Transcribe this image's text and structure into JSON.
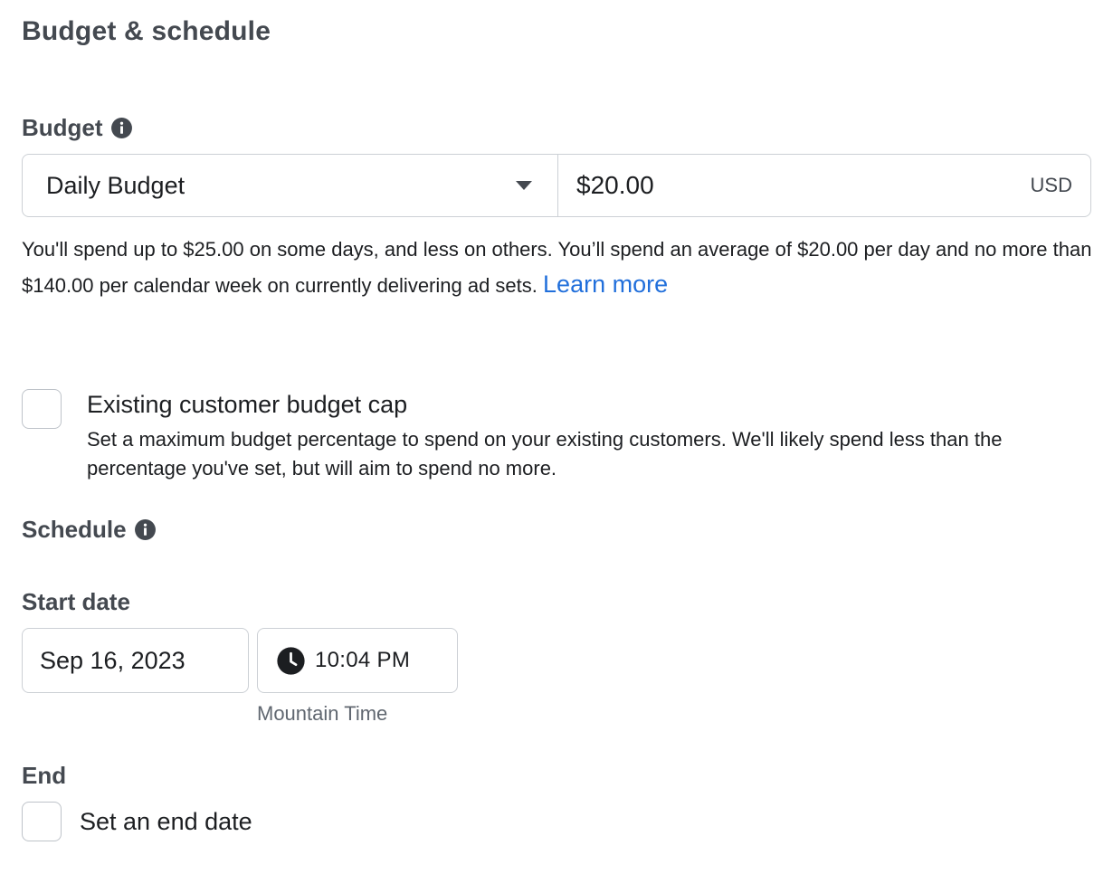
{
  "section": {
    "title": "Budget & schedule"
  },
  "budget": {
    "label": "Budget",
    "type_selected": "Daily Budget",
    "amount": "$20.00",
    "currency": "USD",
    "help_text": "You'll spend up to $25.00 on some days, and less on others. You’ll spend an average of $20.00 per day and no more than $140.00 per calendar week on currently delivering ad sets.",
    "learn_more": "Learn more"
  },
  "customer_cap": {
    "title": "Existing customer budget cap",
    "description": "Set a maximum budget percentage to spend on your existing customers. We'll likely spend less than the percentage you've set, but will aim to spend no more.",
    "checked": false
  },
  "schedule": {
    "label": "Schedule",
    "start_label": "Start date",
    "start_date": "Sep 16, 2023",
    "start_time": "10:04 PM",
    "timezone": "Mountain Time",
    "end_label": "End",
    "end_checkbox_label": "Set an end date",
    "end_checked": false
  },
  "colors": {
    "heading": "#444950",
    "text": "#1c1e21",
    "link": "#216fdb",
    "border": "#ccd0d5",
    "muted": "#606770"
  },
  "icons": {
    "info": "info-icon",
    "dropdown": "caret-down-icon",
    "clock": "clock-icon"
  }
}
